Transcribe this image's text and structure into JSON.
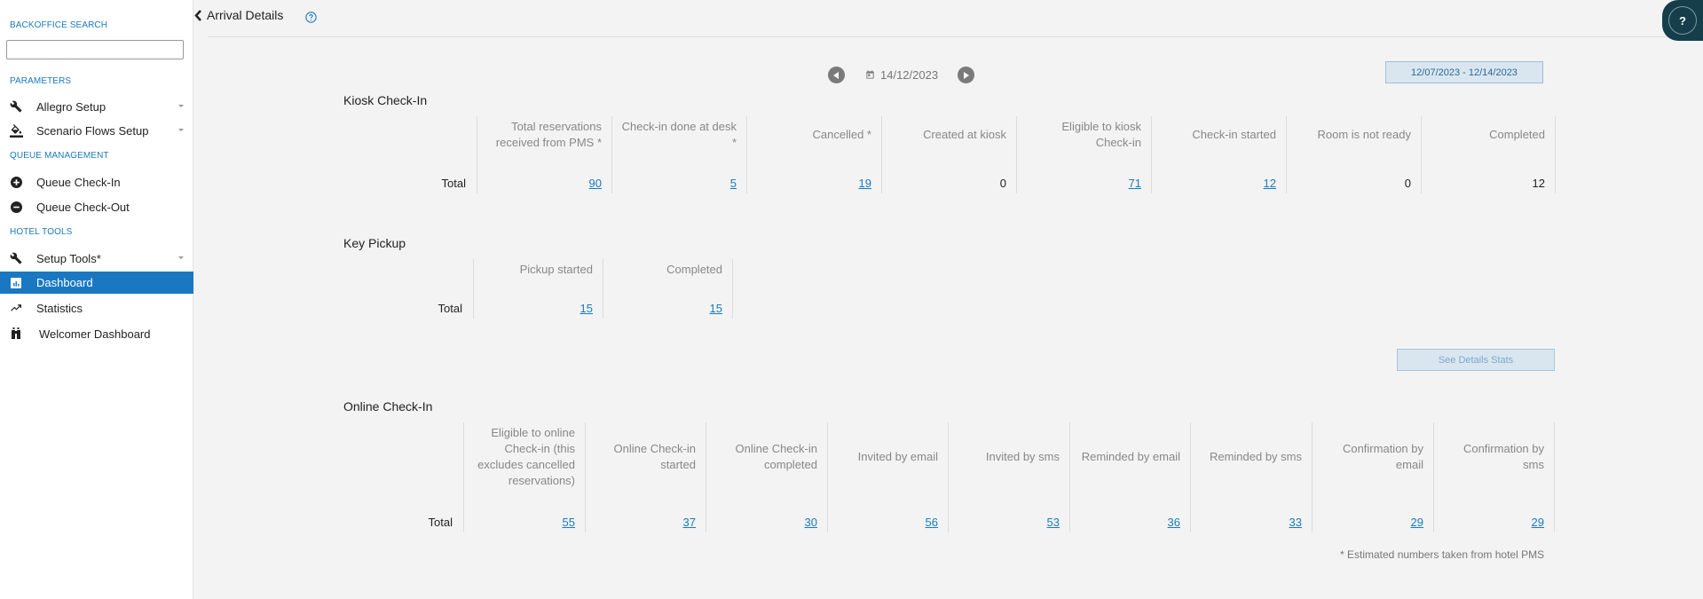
{
  "sidebar": {
    "backoffice_search_title": "BACKOFFICE SEARCH",
    "search_value": "",
    "sections": [
      {
        "title": "PARAMETERS"
      },
      {
        "title": "QUEUE MANAGEMENT"
      },
      {
        "title": "HOTEL TOOLS"
      }
    ],
    "items": [
      {
        "label": "Allegro Setup",
        "icon": "wrench-icon"
      },
      {
        "label": "Scenario Flows Setup",
        "icon": "paint-bucket-icon"
      },
      {
        "label": "Queue Check-In",
        "icon": "plus-circle-icon"
      },
      {
        "label": "Queue Check-Out",
        "icon": "minus-circle-icon"
      },
      {
        "label": "Setup Tools*",
        "icon": "wrench-icon"
      },
      {
        "label": "Dashboard",
        "icon": "bar-chart-icon",
        "active": true
      },
      {
        "label": "Statistics",
        "icon": "trending-up-icon"
      },
      {
        "label": "Welcomer Dashboard",
        "icon": "welcomer-icon"
      }
    ]
  },
  "header": {
    "title": "Arrival Details",
    "help_fab_label": "?"
  },
  "date_nav": {
    "date": "14/12/2023",
    "range": "12/07/2023 - 12/14/2023"
  },
  "kiosk": {
    "title": "Kiosk Check-In",
    "row_label": "Total",
    "columns": [
      {
        "header": "Total reservations received from PMS *",
        "value": "90",
        "link": true
      },
      {
        "header": "Check-in done at desk *",
        "value": "5",
        "link": true
      },
      {
        "header": "Cancelled *",
        "value": "19",
        "link": true
      },
      {
        "header": "Created at kiosk",
        "value": "0",
        "link": false
      },
      {
        "header": "Eligible to kiosk Check-in",
        "value": "71",
        "link": true
      },
      {
        "header": "Check-in started",
        "value": "12",
        "link": true
      },
      {
        "header": "Room is not ready",
        "value": "0",
        "link": false
      },
      {
        "header": "Completed",
        "value": "12",
        "link": false
      }
    ]
  },
  "key_pickup": {
    "title": "Key Pickup",
    "row_label": "Total",
    "columns": [
      {
        "header": "Pickup started",
        "value": "15",
        "link": true
      },
      {
        "header": "Completed",
        "value": "15",
        "link": true
      }
    ]
  },
  "see_details_label": "See Details Stats",
  "online": {
    "title": "Online Check-In",
    "row_label": "Total",
    "columns": [
      {
        "header": "Eligible to online Check-in (this excludes cancelled reservations)",
        "value": "55",
        "link": true
      },
      {
        "header": "Online Check-in started",
        "value": "37",
        "link": true
      },
      {
        "header": "Online Check-in completed",
        "value": "30",
        "link": true
      },
      {
        "header": "Invited by email",
        "value": "56",
        "link": true
      },
      {
        "header": "Invited by sms",
        "value": "53",
        "link": true
      },
      {
        "header": "Reminded by email",
        "value": "36",
        "link": true
      },
      {
        "header": "Reminded by sms",
        "value": "33",
        "link": true
      },
      {
        "header": "Confirmation by email",
        "value": "29",
        "link": true
      },
      {
        "header": "Confirmation by sms",
        "value": "29",
        "link": true
      }
    ]
  },
  "footnote": "* Estimated numbers taken from hotel PMS"
}
